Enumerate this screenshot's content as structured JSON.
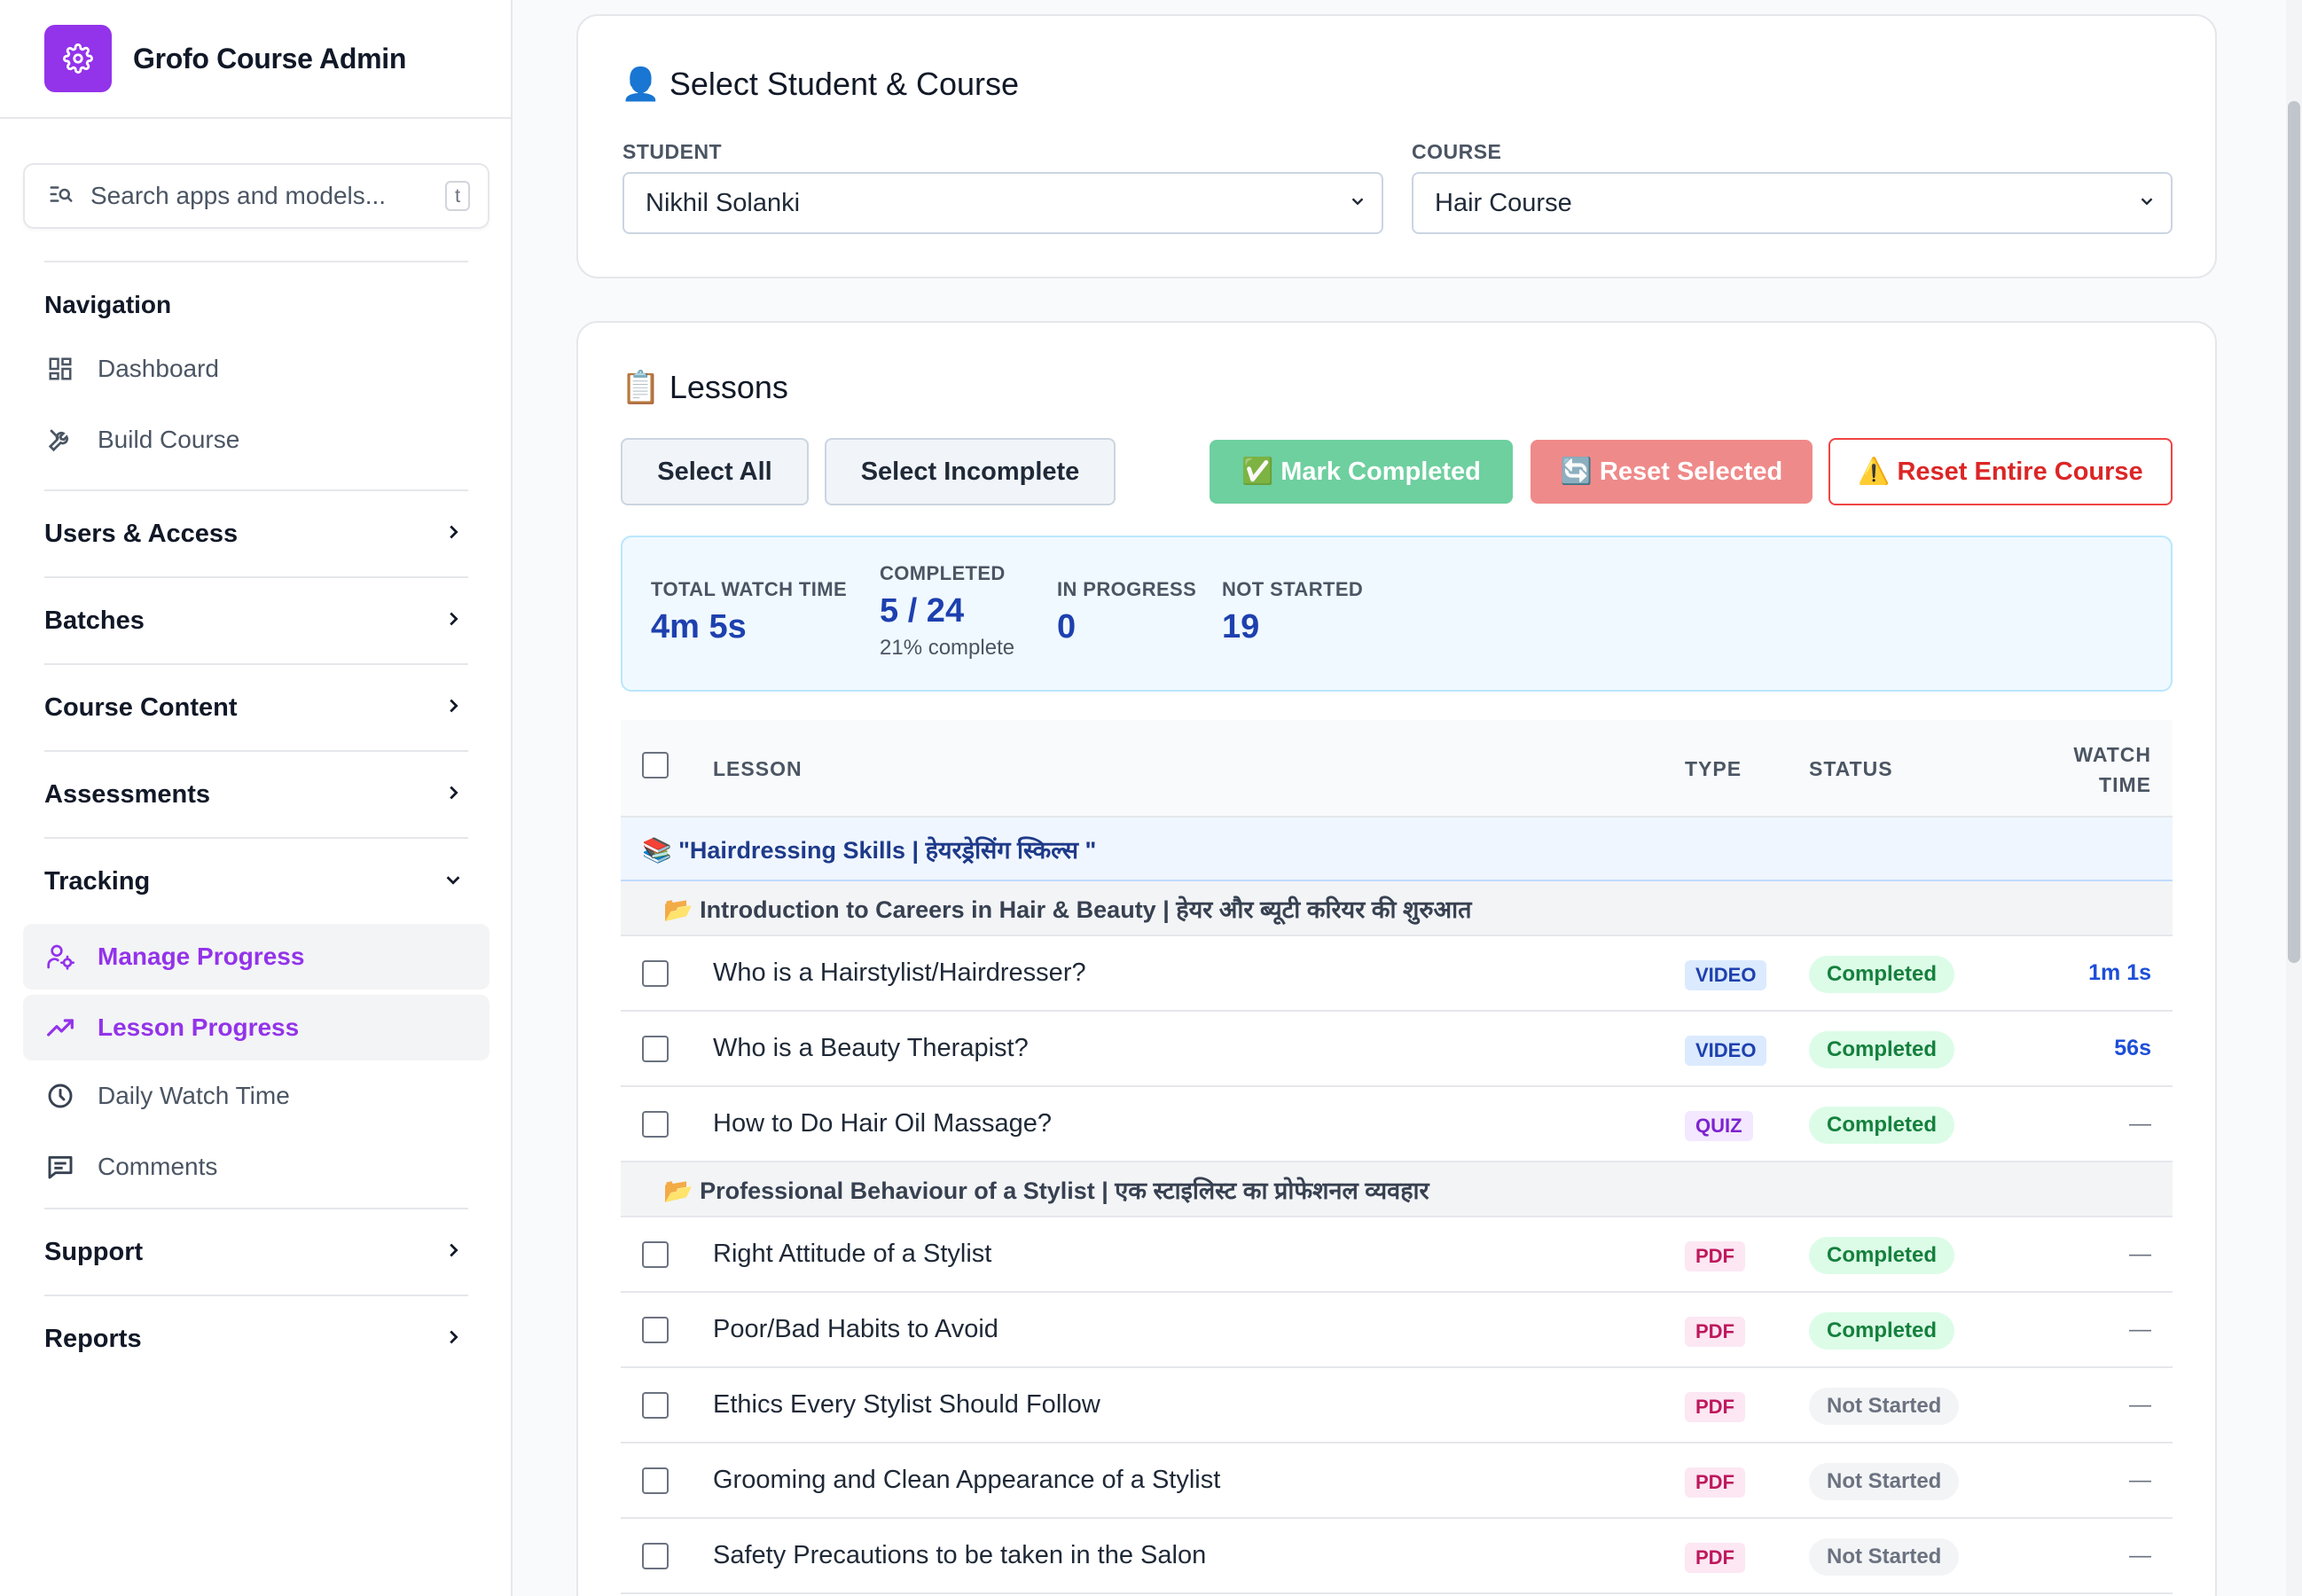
{
  "sidebar": {
    "brand_title": "Grofo Course Admin",
    "search_placeholder": "Search apps and models...",
    "search_shortcut": "t",
    "navigation_heading": "Navigation",
    "navigation_items": [
      {
        "label": "Dashboard",
        "icon": "dashboard-icon"
      },
      {
        "label": "Build Course",
        "icon": "tools-icon"
      }
    ],
    "groups": {
      "users_access": "Users & Access",
      "batches": "Batches",
      "course_content": "Course Content",
      "assessments": "Assessments",
      "tracking": "Tracking",
      "support": "Support",
      "reports": "Reports"
    },
    "tracking_items": [
      {
        "label": "Manage Progress",
        "icon": "user-gear-icon",
        "active": true
      },
      {
        "label": "Lesson Progress",
        "icon": "trending-up-icon",
        "active": true
      },
      {
        "label": "Daily Watch Time",
        "icon": "clock-icon",
        "active": false
      },
      {
        "label": "Comments",
        "icon": "comment-icon",
        "active": false
      }
    ]
  },
  "selector": {
    "title": "Select Student & Course",
    "title_emoji": "👤",
    "student_label": "STUDENT",
    "student_value": "Nikhil Solanki",
    "course_label": "COURSE",
    "course_value": "Hair Course"
  },
  "lessons": {
    "title": "Lessons",
    "title_emoji": "📋",
    "buttons": {
      "select_all": "Select All",
      "select_incomplete": "Select Incomplete",
      "mark_completed": "✅ Mark Completed",
      "reset_selected": "🔄 Reset Selected",
      "reset_entire": "⚠️ Reset Entire Course"
    },
    "stats": {
      "watch_label": "TOTAL WATCH TIME",
      "watch_value": "4m 5s",
      "completed_label": "COMPLETED",
      "completed_value": "5 / 24",
      "completed_sub": "21% complete",
      "inprogress_label": "IN PROGRESS",
      "inprogress_value": "0",
      "notstarted_label": "NOT STARTED",
      "notstarted_value": "19"
    },
    "table_headers": {
      "lesson": "LESSON",
      "type": "TYPE",
      "status": "STATUS",
      "watch_line1": "WATCH",
      "watch_line2": "TIME"
    },
    "section": "📚 \"Hairdressing Skills | हेयरड्रेसिंग स्किल्स \"",
    "modules": [
      {
        "title": "📂 Introduction to Careers in Hair & Beauty | हेयर और ब्यूटी करियर की शुरुआत",
        "rows": [
          {
            "name": "Who is a Hairstylist/Hairdresser?",
            "type": "VIDEO",
            "status": "Completed",
            "watch": "1m 1s"
          },
          {
            "name": "Who is a Beauty Therapist?",
            "type": "VIDEO",
            "status": "Completed",
            "watch": "56s"
          },
          {
            "name": "How to Do Hair Oil Massage?",
            "type": "QUIZ",
            "status": "Completed",
            "watch": "—"
          }
        ]
      },
      {
        "title": "📂 Professional Behaviour of a Stylist | एक स्टाइलिस्ट का प्रोफेशनल व्यवहार",
        "rows": [
          {
            "name": "Right Attitude of a Stylist",
            "type": "PDF",
            "status": "Completed",
            "watch": "—"
          },
          {
            "name": "Poor/Bad Habits to Avoid",
            "type": "PDF",
            "status": "Completed",
            "watch": "—"
          },
          {
            "name": "Ethics Every Stylist Should Follow",
            "type": "PDF",
            "status": "Not Started",
            "watch": "—"
          },
          {
            "name": "Grooming and Clean Appearance of a Stylist",
            "type": "PDF",
            "status": "Not Started",
            "watch": "—"
          },
          {
            "name": "Safety Precautions to be taken in the Salon",
            "type": "PDF",
            "status": "Not Started",
            "watch": "—"
          }
        ]
      }
    ]
  },
  "colors": {
    "brand": "#9333ea",
    "accent_blue": "#1e40af",
    "completed_green": "#15803d",
    "danger_red": "#dc2626"
  }
}
